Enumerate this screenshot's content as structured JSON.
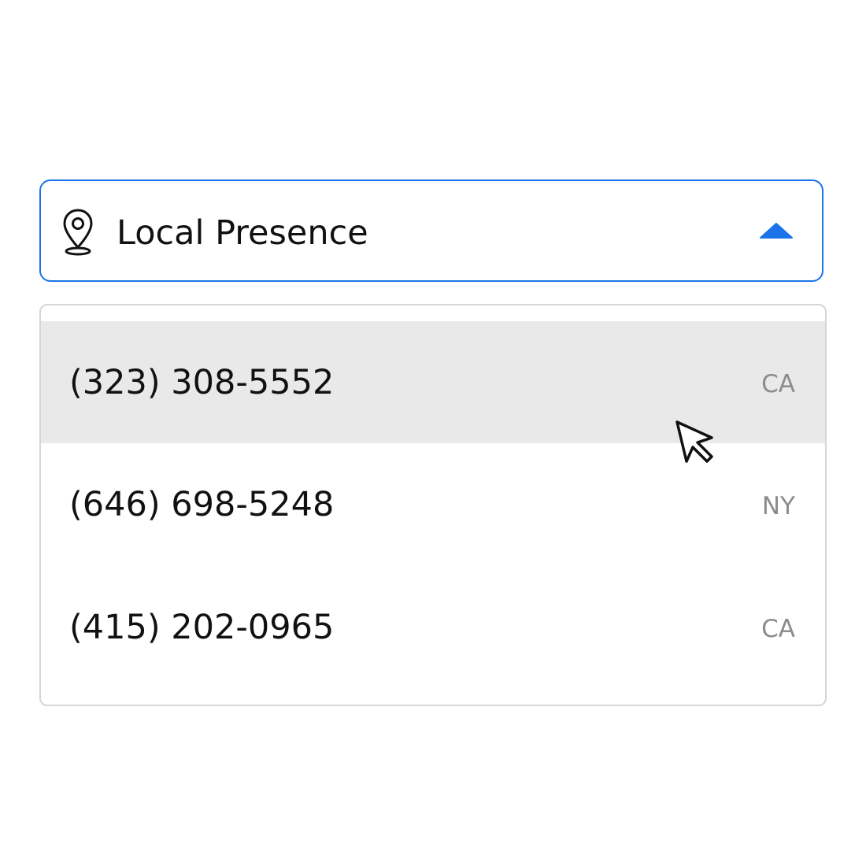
{
  "select": {
    "label": "Local Presence",
    "icon": "location-pin-icon",
    "expanded": true,
    "caret_icon": "caret-up-icon",
    "accent_color": "#1a73e8"
  },
  "options": [
    {
      "number": "(323) 308-5552",
      "state": "CA",
      "hovered": true
    },
    {
      "number": "(646) 698-5248",
      "state": "NY",
      "hovered": false
    },
    {
      "number": "(415) 202-0965",
      "state": "CA",
      "hovered": false
    }
  ],
  "cursor": {
    "icon": "mouse-pointer-icon"
  }
}
